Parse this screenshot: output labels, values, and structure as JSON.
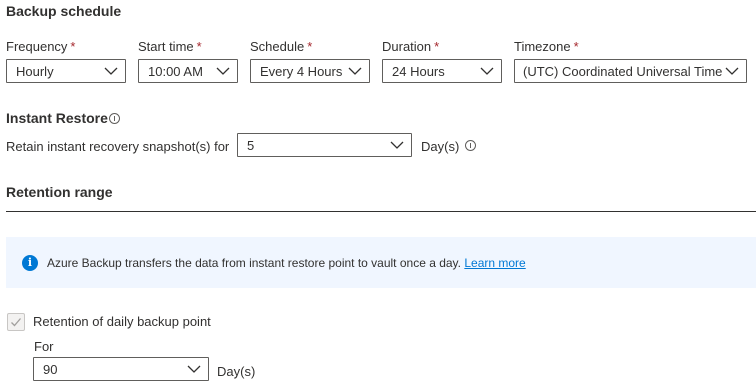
{
  "backup_schedule": {
    "heading": "Backup schedule",
    "frequency": {
      "label": "Frequency",
      "required_mark": "*",
      "value": "Hourly"
    },
    "start_time": {
      "label": "Start time",
      "required_mark": "*",
      "value": "10:00 AM"
    },
    "schedule": {
      "label": "Schedule",
      "required_mark": "*",
      "value": "Every 4 Hours"
    },
    "duration": {
      "label": "Duration",
      "required_mark": "*",
      "value": "24 Hours"
    },
    "timezone": {
      "label": "Timezone",
      "required_mark": "*",
      "value": "(UTC) Coordinated Universal Time"
    }
  },
  "instant_restore": {
    "heading": "Instant Restore",
    "retain_label": "Retain instant recovery snapshot(s) for",
    "retain_value": "5",
    "unit": "Day(s)"
  },
  "retention_range": {
    "heading": "Retention range",
    "banner": {
      "text": "Azure Backup transfers the data from instant restore point to vault once a day.",
      "link": "Learn more",
      "icon_glyph": "i"
    },
    "daily": {
      "checkbox_label": "Retention of daily backup point",
      "checked": true,
      "for_label": "For",
      "value": "90",
      "unit": "Day(s)"
    }
  },
  "colors": {
    "accent": "#0078d4",
    "required": "#a4262c",
    "banner_bg": "#f0f6ff",
    "text": "#323130"
  }
}
